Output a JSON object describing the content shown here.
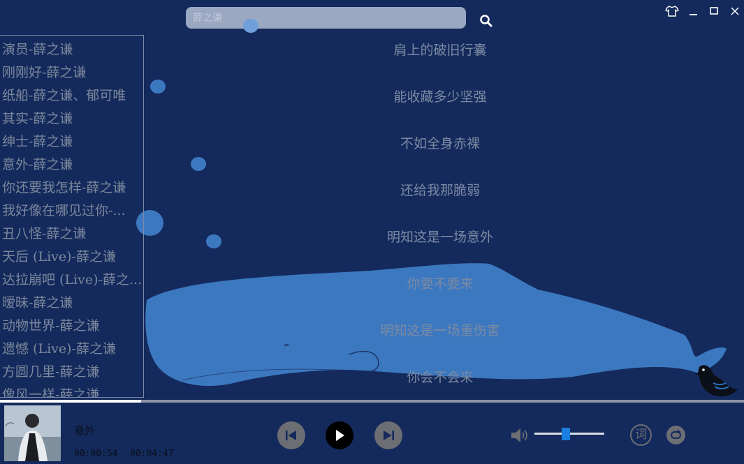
{
  "search": {
    "placeholder": "薛之谦",
    "value": ""
  },
  "playlist": [
    "演员-薛之谦",
    "刚刚好-薛之谦",
    "纸船-薛之谦、郁可唯",
    "其实-薛之谦",
    "绅士-薛之谦",
    " 意外-薛之谦",
    "你还要我怎样-薛之谦",
    "我好像在哪见过你-...",
    "丑八怪-薛之谦",
    "天后 (Live)-薛之谦",
    "达拉崩吧 (Live)-薛之...",
    "暧昧-薛之谦",
    "动物世界-薛之谦",
    "遗憾 (Live)-薛之谦",
    "方圆几里-薛之谦",
    "像风一样-薛之谦"
  ],
  "lyrics": [
    "肩上的破旧行囊",
    "能收藏多少坚强",
    "不如全身赤裸",
    "还给我那脆弱",
    "明知这是一场意外",
    "你要不要来",
    "明知这是一场重伤害",
    "你会不会来"
  ],
  "player": {
    "song_title": "意外",
    "current_time": "00:00:54",
    "total_time": "00:04:47",
    "progress": 0.19,
    "volume": 0.45,
    "lyric_button": "词"
  },
  "icons": {
    "search": "search-icon",
    "skin": "shirt-icon",
    "minimize": "minimize-icon",
    "maximize": "maximize-icon",
    "close": "close-icon",
    "prev": "skip-previous-icon",
    "play": "play-icon",
    "next": "skip-next-icon",
    "volume": "volume-icon",
    "loop": "loop-icon"
  },
  "colors": {
    "background": "#142a5c",
    "whale": "#3c78c0",
    "accent": "#1a7fe0"
  }
}
